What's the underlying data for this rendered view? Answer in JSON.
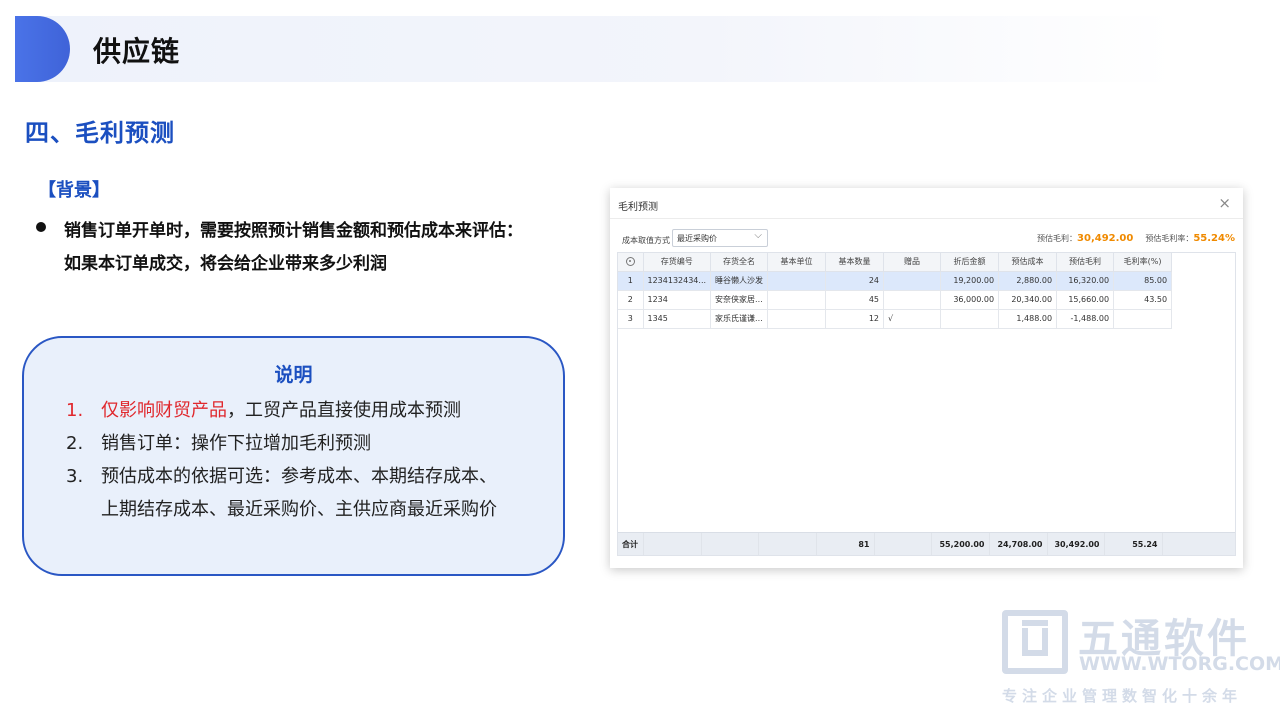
{
  "header": {
    "title": "供应链"
  },
  "section": {
    "title": "四、毛利预测"
  },
  "background": {
    "title": "【背景】",
    "bullet_line1": "销售订单开单时，需要按照预计销售金额和预估成本来评估：",
    "bullet_line2": "如果本订单成交，将会给企业带来多少利润"
  },
  "note": {
    "title": "说明",
    "items": [
      {
        "num": "1.",
        "red": "仅影响财贸产品",
        "text": "，工贸产品直接使用成本预测"
      },
      {
        "num": "2.",
        "text": "销售订单：操作下拉增加毛利预测"
      },
      {
        "num": "3.",
        "text": "预估成本的依据可选：参考成本、本期结存成本、"
      },
      {
        "text": "上期结存成本、最近采购价、主供应商最近采购价"
      }
    ]
  },
  "dialog": {
    "title": "毛利预测",
    "close": "×",
    "cost_label": "成本取值方式",
    "cost_value": "最近采购价",
    "est_profit_label": "预估毛利：",
    "est_profit_value": "30,492.00",
    "est_rate_label": "预估毛利率：",
    "est_rate_value": "55.24%",
    "columns": [
      "",
      "存货编号",
      "存货全名",
      "基本单位",
      "基本数量",
      "赠品",
      "折后金额",
      "预估成本",
      "预估毛利",
      "毛利率(%)"
    ],
    "rows": [
      [
        "1",
        "1234132434...",
        "睡谷懒人沙发",
        "",
        "24",
        "",
        "19,200.00",
        "2,880.00",
        "16,320.00",
        "85.00"
      ],
      [
        "2",
        "1234",
        "安奈侠家居...",
        "",
        "45",
        "",
        "36,000.00",
        "20,340.00",
        "15,660.00",
        "43.50"
      ],
      [
        "3",
        "1345",
        "家乐氏谨谦...",
        "",
        "12",
        "√",
        "",
        "1,488.00",
        "-1,488.00",
        ""
      ]
    ],
    "footer": [
      "合计",
      "",
      "",
      "",
      "81",
      "",
      "55,200.00",
      "24,708.00",
      "30,492.00",
      "55.24"
    ]
  },
  "watermark": {
    "name": "五通软件",
    "url": "WWW.WTORG.COM",
    "tagline": "专注企业管理数智化十余年"
  },
  "colors": {
    "accent_blue": "#1b4fc0",
    "highlight_red": "#e0282d",
    "orange": "#f08a00"
  }
}
